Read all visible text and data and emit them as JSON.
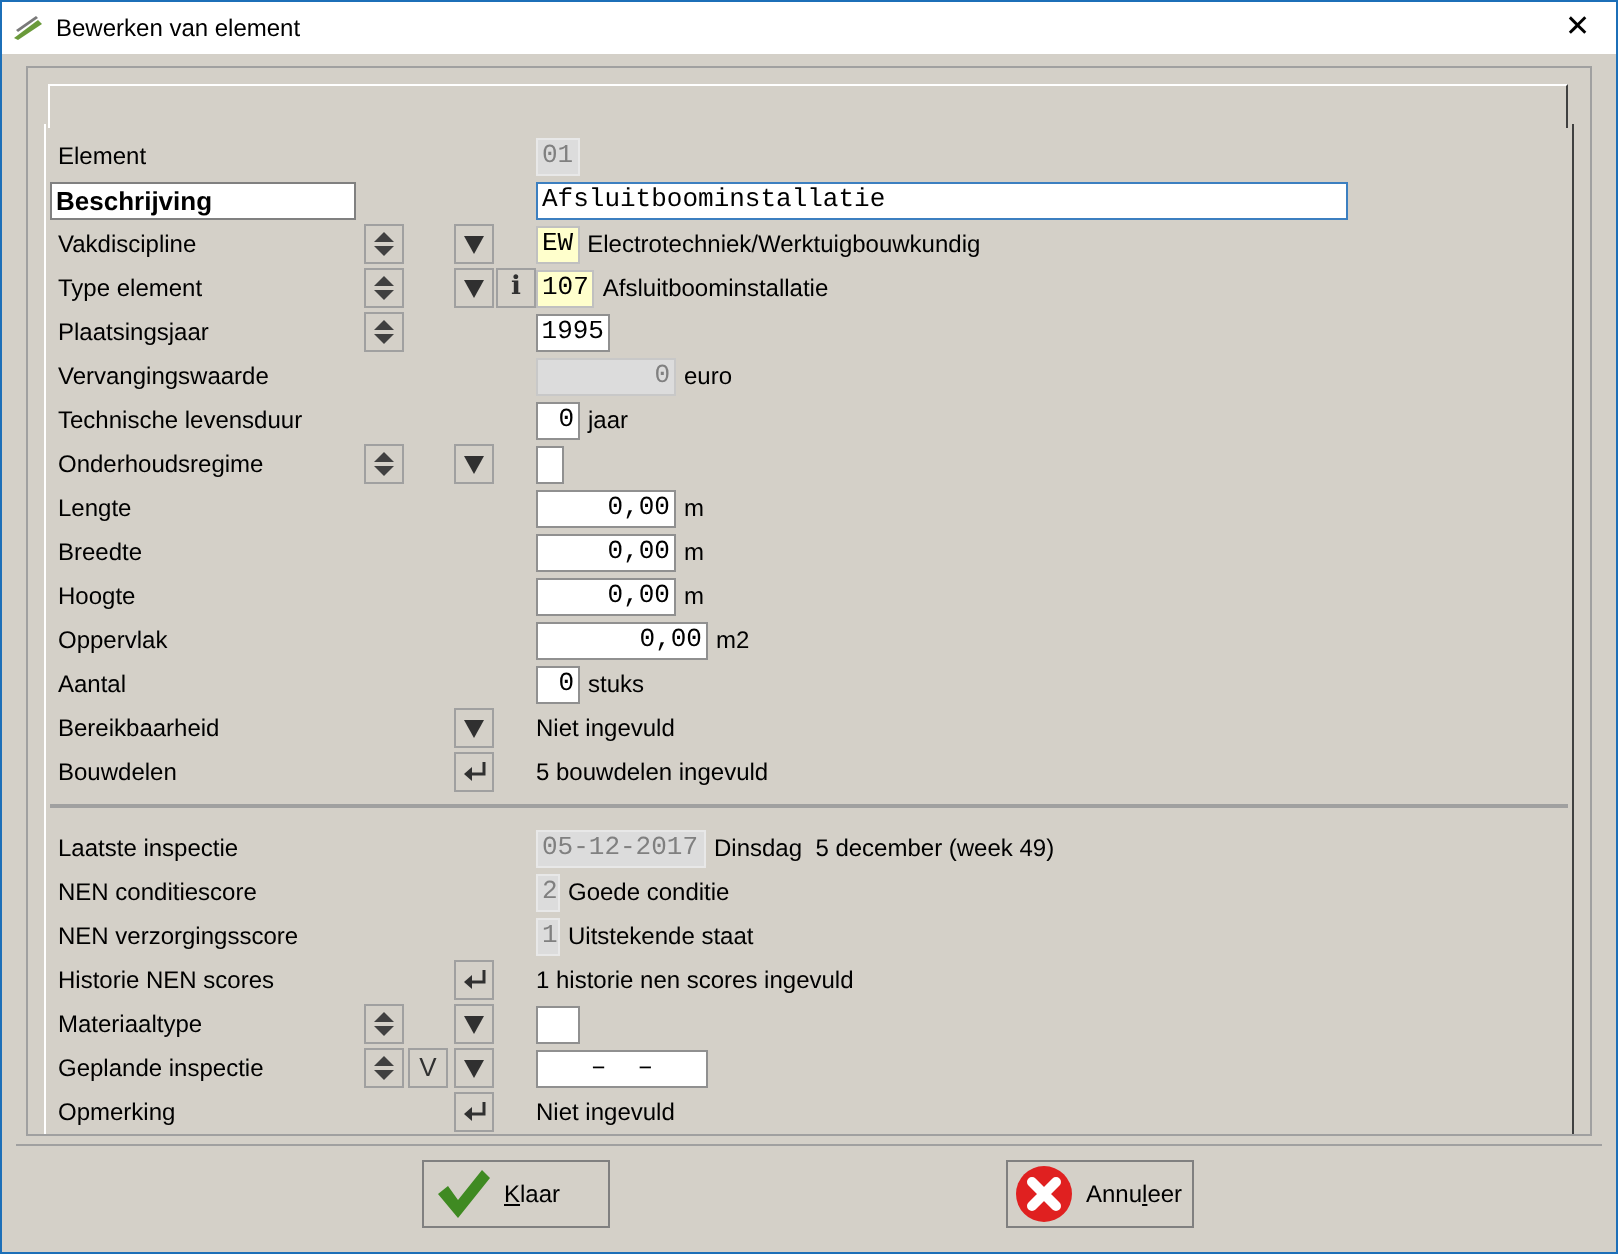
{
  "window": {
    "title": "Bewerken van element",
    "close": "✕"
  },
  "sections": [
    {
      "rows": [
        {
          "label": "Element",
          "emphasized": false,
          "spinner": false,
          "dropdown": false,
          "enter": false,
          "field": {
            "kind": "id",
            "text": "01"
          }
        },
        {
          "label": "Beschrijving",
          "emphasized": true,
          "spinner": false,
          "dropdown": false,
          "enter": false,
          "field": {
            "kind": "description",
            "text": "Afsluitboominstallatie"
          }
        },
        {
          "label": "Vakdiscipline",
          "emphasized": false,
          "spinner": true,
          "dropdown": true,
          "enter": false,
          "field": {
            "kind": "code",
            "text": "EW"
          },
          "value": "Electrotechniek/Werktuigbouwkundig"
        },
        {
          "label": "Type element",
          "emphasized": false,
          "spinner": true,
          "dropdown": true,
          "enter": false,
          "info": "i",
          "field": {
            "kind": "code",
            "text": "107"
          },
          "value": "Afsluitboominstallatie"
        },
        {
          "label": "Plaatsingsjaar",
          "emphasized": false,
          "spinner": true,
          "dropdown": false,
          "enter": false,
          "field": {
            "kind": "year",
            "text": "1995"
          }
        },
        {
          "label": "Vervangingswaarde",
          "emphasized": false,
          "spinner": false,
          "dropdown": false,
          "enter": false,
          "field": {
            "kind": "amount",
            "text": "0"
          },
          "value": "euro"
        },
        {
          "label": "Technische levensduur",
          "emphasized": false,
          "spinner": false,
          "dropdown": false,
          "enter": false,
          "field": {
            "kind": "count",
            "text": "0"
          },
          "value": "jaar"
        },
        {
          "label": "Onderhoudsregime",
          "emphasized": false,
          "spinner": true,
          "dropdown": true,
          "enter": false,
          "field": {
            "kind": "narrow"
          }
        },
        {
          "label": "Lengte",
          "emphasized": false,
          "spinner": false,
          "dropdown": false,
          "enter": false,
          "field": {
            "kind": "measure",
            "text": "0,00"
          },
          "value": "m"
        },
        {
          "label": "Breedte",
          "emphasized": false,
          "spinner": false,
          "dropdown": false,
          "enter": false,
          "field": {
            "kind": "measure",
            "text": "0,00"
          },
          "value": "m"
        },
        {
          "label": "Hoogte",
          "emphasized": false,
          "spinner": false,
          "dropdown": false,
          "enter": false,
          "field": {
            "kind": "measure",
            "text": "0,00"
          },
          "value": "m"
        },
        {
          "label": "Oppervlak",
          "emphasized": false,
          "spinner": false,
          "dropdown": false,
          "enter": false,
          "field": {
            "kind": "area",
            "text": "0,00"
          },
          "value": "m2"
        },
        {
          "label": "Aantal",
          "emphasized": false,
          "spinner": false,
          "dropdown": false,
          "enter": false,
          "field": {
            "kind": "count",
            "text": "0"
          },
          "value": "stuks"
        },
        {
          "label": "Bereikbaarheid",
          "emphasized": false,
          "spinner": false,
          "dropdown": true,
          "enter": false,
          "value": "Niet ingevuld"
        },
        {
          "label": "Bouwdelen",
          "emphasized": false,
          "spinner": false,
          "dropdown": false,
          "enter": true,
          "value": "5 bouwdelen ingevuld"
        }
      ]
    },
    {
      "rows": [
        {
          "label": "Laatste inspectie",
          "emphasized": false,
          "spinner": false,
          "dropdown": false,
          "enter": false,
          "field": {
            "kind": "date",
            "text": "05-12-2017"
          },
          "value": "Dinsdag  5 december (week 49)"
        },
        {
          "label": "NEN conditiescore",
          "emphasized": false,
          "spinner": false,
          "dropdown": false,
          "enter": false,
          "field": {
            "kind": "score",
            "text": "2"
          },
          "value": "Goede conditie"
        },
        {
          "label": "NEN verzorgingsscore",
          "emphasized": false,
          "spinner": false,
          "dropdown": false,
          "enter": false,
          "field": {
            "kind": "score",
            "text": "1"
          },
          "value": "Uitstekende staat"
        },
        {
          "label": "Historie NEN scores",
          "emphasized": false,
          "spinner": false,
          "dropdown": false,
          "enter": true,
          "value": "1 historie nen scores ingevuld"
        },
        {
          "label": "Materiaaltype",
          "emphasized": false,
          "spinner": true,
          "dropdown": true,
          "enter": false,
          "field": {
            "kind": "small"
          }
        },
        {
          "label": "Geplande inspectie",
          "emphasized": false,
          "spinner": true,
          "v_button": "V",
          "dropdown": true,
          "enter": false,
          "field": {
            "kind": "planned",
            "text": "–  –"
          }
        },
        {
          "label": "Opmerking",
          "emphasized": false,
          "spinner": false,
          "dropdown": false,
          "enter": true,
          "value": "Niet ingevuld"
        }
      ]
    }
  ],
  "buttons": [
    {
      "kind": "ok",
      "label_parts": [
        {
          "text": "K",
          "underlined": true
        },
        {
          "text": "laar",
          "underlined": false
        }
      ]
    },
    {
      "kind": "cancel",
      "label_parts": [
        {
          "text": "Annu",
          "underlined": false
        },
        {
          "text": "l",
          "underlined": true
        },
        {
          "text": "eer",
          "underlined": false
        }
      ]
    }
  ]
}
